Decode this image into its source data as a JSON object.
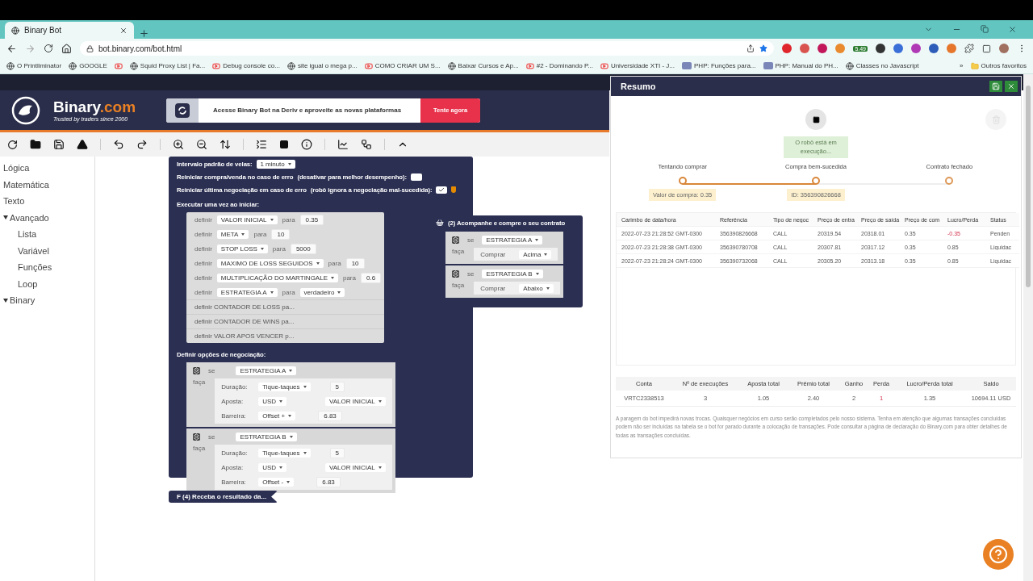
{
  "browser": {
    "tab_title": "Binary Bot",
    "url": "bot.binary.com/bot.html",
    "extension_badge": "5.49",
    "bookmarks": [
      {
        "label": "O Printliminator",
        "kind": "site"
      },
      {
        "label": "GOOGLE",
        "kind": "site"
      },
      {
        "kind": "video"
      },
      {
        "label": "Squid Proxy List | Fa...",
        "kind": "site"
      },
      {
        "label": "Debug console co...",
        "kind": "video"
      },
      {
        "label": "site igual o mega p...",
        "kind": "site"
      },
      {
        "label": "COMO CRIAR UM S...",
        "kind": "video"
      },
      {
        "label": "Baixar Cursos e Ap...",
        "kind": "site"
      },
      {
        "label": "#2 - Dominando P...",
        "kind": "video"
      },
      {
        "label": "Universidade XTI - J...",
        "kind": "video"
      },
      {
        "label": "PHP: Funções para...",
        "kind": "php"
      },
      {
        "label": "PHP: Manual do PH...",
        "kind": "php"
      },
      {
        "label": "Classes no Javascript",
        "kind": "site"
      }
    ],
    "more": "»",
    "other_bookmarks": "Outros favoritos"
  },
  "header": {
    "brand": "Binary",
    "brand_suffix": ".com",
    "tagline": "Trusted by traders since 2000",
    "banner_text": "Acesse Binary Bot na Deriv e aproveite as novas plataformas",
    "banner_button": "Tente agora"
  },
  "sidebar": {
    "items": [
      {
        "label": "Lógica",
        "kind": "item"
      },
      {
        "label": "Matemática",
        "kind": "item"
      },
      {
        "label": "Texto",
        "kind": "item"
      },
      {
        "label": "Avançado",
        "kind": "category",
        "expanded": true,
        "children": [
          {
            "label": "Lista"
          },
          {
            "label": "Variável"
          },
          {
            "label": "Funções"
          },
          {
            "label": "Loop"
          }
        ]
      },
      {
        "label": "Binary",
        "kind": "category",
        "expanded": true
      }
    ]
  },
  "trade_block": {
    "interval_label": "Intervalo padrão de velas:",
    "interval_value": "1 minuto",
    "options": [
      {
        "label": "Reiniciar compra/venda no caso de erro",
        "note": "(desativar para melhor desempenho):",
        "checked": false,
        "warning": false
      },
      {
        "label": "Reiniciar última negociação em caso de erro",
        "note": "(robô ignora a negociação mal-sucedida):",
        "checked": true,
        "warning": true
      }
    ],
    "init_label": "Executar uma vez ao iniciar:",
    "init_statements": [
      {
        "kind": "set_number",
        "keyword": "definir",
        "variable": "VALOR INICIAL",
        "to": "para",
        "value": "0.35"
      },
      {
        "kind": "set_number",
        "keyword": "definir",
        "variable": "META",
        "to": "para",
        "value": "10"
      },
      {
        "kind": "set_number",
        "keyword": "definir",
        "variable": "STOP LOSS",
        "to": "para",
        "value": "5000"
      },
      {
        "kind": "set_number",
        "keyword": "definir",
        "variable": "MAXIMO DE LOSS SEGUIDOS",
        "to": "para",
        "value": "10"
      },
      {
        "kind": "set_number",
        "keyword": "definir",
        "variable": "MULTIPLICAÇÃO DO MARTINGALE",
        "to": "para",
        "value": "0.6"
      },
      {
        "kind": "set_choice",
        "keyword": "definir",
        "variable": "ESTRATEGIA A",
        "to": "para",
        "value": "verdadeiro"
      },
      {
        "kind": "collapsed",
        "text": "definir CONTADOR DE LOSS pa..."
      },
      {
        "kind": "collapsed",
        "text": "definir CONTADOR DE WINS pa..."
      },
      {
        "kind": "collapsed",
        "text": "definir VALOR APOS VENCER p..."
      }
    ],
    "options_label": "Definir opções de negociação:",
    "conditions": [
      {
        "if": "se",
        "condition": "ESTRATEGIA A",
        "do": "faça",
        "duration_label": "Duração:",
        "duration_unit": "Tique-taques",
        "duration_value": "5",
        "stake_label": "Aposta:",
        "currency": "USD",
        "stake_value": "VALOR INICIAL",
        "barrier_label": "Barreira:",
        "barrier_type": "Offset +",
        "barrier_value": "6.83"
      },
      {
        "if": "se",
        "condition": "ESTRATEGIA B",
        "do": "faça",
        "duration_label": "Duração:",
        "duration_unit": "Tique-taques",
        "duration_value": "5",
        "stake_label": "Aposta:",
        "currency": "USD",
        "stake_value": "VALOR INICIAL",
        "barrier_label": "Barreira:",
        "barrier_type": "Offset -",
        "barrier_value": "6.83"
      }
    ]
  },
  "purchase_block": {
    "title": "(2) Acompanhe e compre o seu contrato",
    "conditions": [
      {
        "if": "se",
        "condition": "ESTRATEGIA A",
        "do": "faça",
        "action": "Comprar",
        "direction": "Acima"
      },
      {
        "if": "se",
        "condition": "ESTRATEGIA B",
        "do": "faça",
        "action": "Comprar",
        "direction": "Abaixo"
      }
    ]
  },
  "result_block": {
    "title": "F (4) Receba o resultado da..."
  },
  "summary_panel": {
    "title": "Resumo",
    "status": "O robô está em execução...",
    "steps": [
      {
        "label": "Tentando comprar",
        "reached": true,
        "note": "Valor de compra: 0.35"
      },
      {
        "label": "Compra bem-sucedida",
        "reached": true,
        "note": "ID: 356390826668"
      },
      {
        "label": "Contrato fechado",
        "reached": false
      }
    ],
    "table": {
      "columns": [
        "Carimbo de data/hora",
        "Referência",
        "Tipo de negoc",
        "Preço de entra",
        "Preço de saída",
        "Preço de com",
        "Lucro/Perda",
        "Status"
      ],
      "rows": [
        {
          "cells": [
            "2022-07-23 21:28:52 GMT-0300",
            "356390826668",
            "CALL",
            "20319.54",
            "20318.01",
            "0.35",
            "-0.35",
            "Penden"
          ],
          "negative": true
        },
        {
          "cells": [
            "2022-07-23 21:28:38 GMT-0300",
            "356390780708",
            "CALL",
            "20307.81",
            "20317.12",
            "0.35",
            "0.85",
            "Liquidac"
          ],
          "negative": false
        },
        {
          "cells": [
            "2022-07-23 21:28:24 GMT-0300",
            "356390732068",
            "CALL",
            "20305.20",
            "20313.18",
            "0.35",
            "0.85",
            "Liquidac"
          ],
          "negative": false
        }
      ]
    },
    "totals": [
      {
        "label": "Conta",
        "value": "VRTC2338513",
        "loss": false
      },
      {
        "label": "Nº de execuções",
        "value": "3",
        "loss": false
      },
      {
        "label": "Aposta total",
        "value": "1.05",
        "loss": false
      },
      {
        "label": "Prêmio total",
        "value": "2.40",
        "loss": false
      },
      {
        "label": "Ganho",
        "value": "2",
        "loss": false
      },
      {
        "label": "Perda",
        "value": "1",
        "loss": true
      },
      {
        "label": "Lucro/Perda total",
        "value": "1.35",
        "loss": false
      },
      {
        "label": "Saldo",
        "value": "10694.11 USD",
        "loss": false
      }
    ],
    "disclaimer": "A paragem do bot impedirá novas trocas. Quaisquer negócios em curso serão completados pelo nosso sistema. Tenha em atenção que algumas transações concluídas podem não ser incluídas na tabela se o bot for parado durante a colocação de transações. Pode consultar a página de declaração do Binary.com para obter detalhes de todas as transações concluídas."
  }
}
